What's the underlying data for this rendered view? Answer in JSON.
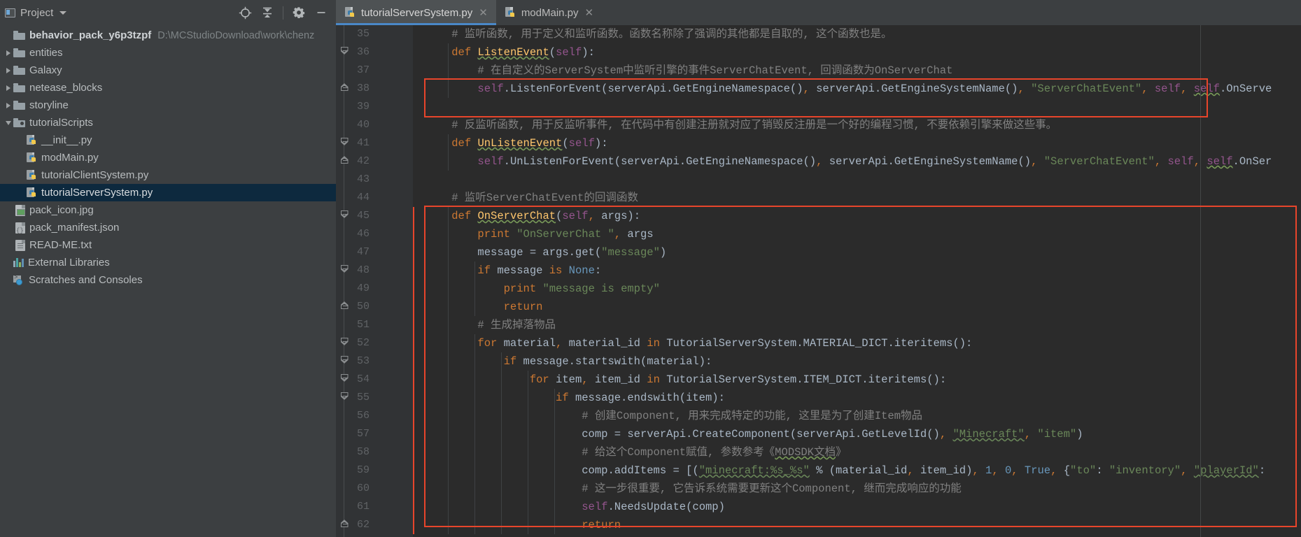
{
  "window": {
    "app": "PyCharm-like IDE",
    "bg": "#3c3f41",
    "editor_bg": "#2b2b2b"
  },
  "project_panel": {
    "title": "Project",
    "title_icon": "project-icon",
    "caret_icon": "chevron-down-icon",
    "toolbar_icons": [
      {
        "name": "locate-target-icon",
        "glyph": "target"
      },
      {
        "name": "collapse-all-icon",
        "glyph": "collapse"
      },
      {
        "name": "settings-gear-icon",
        "glyph": "gear"
      },
      {
        "name": "hide-panel-icon",
        "glyph": "minus"
      }
    ],
    "tree": [
      {
        "label": "behavior_pack_y6p3tzpf",
        "path": "D:\\MCStudioDownload\\work\\chenz",
        "icon": "folder-icon",
        "indent": 0,
        "arrow": "none",
        "bold": true,
        "selected": false
      },
      {
        "label": "entities",
        "path": "",
        "icon": "folder-icon",
        "indent": 1,
        "arrow": "right",
        "bold": false,
        "selected": false
      },
      {
        "label": "Galaxy",
        "path": "",
        "icon": "folder-icon",
        "indent": 1,
        "arrow": "right",
        "bold": false,
        "selected": false
      },
      {
        "label": "netease_blocks",
        "path": "",
        "icon": "folder-icon",
        "indent": 1,
        "arrow": "right",
        "bold": false,
        "selected": false
      },
      {
        "label": "storyline",
        "path": "",
        "icon": "folder-icon",
        "indent": 1,
        "arrow": "right",
        "bold": false,
        "selected": false
      },
      {
        "label": "tutorialScripts",
        "path": "",
        "icon": "source-folder-icon",
        "indent": 1,
        "arrow": "down",
        "bold": false,
        "selected": false
      },
      {
        "label": "__init__.py",
        "path": "",
        "icon": "python-file-icon",
        "indent": 2,
        "arrow": "none",
        "bold": false,
        "selected": false
      },
      {
        "label": "modMain.py",
        "path": "",
        "icon": "python-file-icon",
        "indent": 2,
        "arrow": "none",
        "bold": false,
        "selected": false
      },
      {
        "label": "tutorialClientSystem.py",
        "path": "",
        "icon": "python-file-icon",
        "indent": 2,
        "arrow": "none",
        "bold": false,
        "selected": false
      },
      {
        "label": "tutorialServerSystem.py",
        "path": "",
        "icon": "python-file-icon",
        "indent": 2,
        "arrow": "none",
        "bold": false,
        "selected": true
      },
      {
        "label": "pack_icon.jpg",
        "path": "",
        "icon": "image-file-icon",
        "indent": 3,
        "arrow": "none",
        "bold": false,
        "selected": false
      },
      {
        "label": "pack_manifest.json",
        "path": "",
        "icon": "json-file-icon",
        "indent": 3,
        "arrow": "none",
        "bold": false,
        "selected": false
      },
      {
        "label": "READ-ME.txt",
        "path": "",
        "icon": "text-file-icon",
        "indent": 3,
        "arrow": "none",
        "bold": false,
        "selected": false
      },
      {
        "label": "External Libraries",
        "path": "",
        "icon": "libraries-icon",
        "indent": 0,
        "arrow": "none",
        "bold": false,
        "selected": false
      },
      {
        "label": "Scratches and Consoles",
        "path": "",
        "icon": "scratches-icon",
        "indent": 0,
        "arrow": "none",
        "bold": false,
        "selected": false
      }
    ]
  },
  "tabs": [
    {
      "label": "tutorialServerSystem.py",
      "icon": "python-file-icon",
      "close_icon": "close-icon",
      "active": true
    },
    {
      "label": "modMain.py",
      "icon": "python-file-icon",
      "close_icon": "close-icon",
      "active": false
    }
  ],
  "editor": {
    "first_line_number": 35,
    "last_line_number": 62,
    "line_numbers": [
      35,
      36,
      37,
      38,
      39,
      40,
      41,
      42,
      43,
      44,
      45,
      46,
      47,
      48,
      49,
      50,
      51,
      52,
      53,
      54,
      55,
      56,
      57,
      58,
      59,
      60,
      61,
      62
    ],
    "lines": [
      {
        "n": 35,
        "text": "    # 监听函数, 用于定义和监听函数。函数名称除了强调的其他都是自取的, 这个函数也是。"
      },
      {
        "n": 36,
        "text": "    def ListenEvent(self):"
      },
      {
        "n": 37,
        "text": "        # 在自定义的ServerSystem中监听引擎的事件ServerChatEvent, 回调函数为OnServerChat"
      },
      {
        "n": 38,
        "text": "        self.ListenForEvent(serverApi.GetEngineNamespace(), serverApi.GetEngineSystemName(), \"ServerChatEvent\", self, self.OnServe"
      },
      {
        "n": 39,
        "text": ""
      },
      {
        "n": 40,
        "text": "    # 反监听函数, 用于反监听事件, 在代码中有创建注册就对应了销毁反注册是一个好的编程习惯, 不要依赖引擎来做这些事。"
      },
      {
        "n": 41,
        "text": "    def UnListenEvent(self):"
      },
      {
        "n": 42,
        "text": "        self.UnListenForEvent(serverApi.GetEngineNamespace(), serverApi.GetEngineSystemName(), \"ServerChatEvent\", self, self.OnSer"
      },
      {
        "n": 43,
        "text": ""
      },
      {
        "n": 44,
        "text": "    # 监听ServerChatEvent的回调函数"
      },
      {
        "n": 45,
        "text": "    def OnServerChat(self, args):"
      },
      {
        "n": 46,
        "text": "        print \"OnServerChat \", args"
      },
      {
        "n": 47,
        "text": "        message = args.get(\"message\")"
      },
      {
        "n": 48,
        "text": "        if message is None:"
      },
      {
        "n": 49,
        "text": "            print \"message is empty\""
      },
      {
        "n": 50,
        "text": "            return"
      },
      {
        "n": 51,
        "text": "        # 生成掉落物品"
      },
      {
        "n": 52,
        "text": "        for material, material_id in TutorialServerSystem.MATERIAL_DICT.iteritems():"
      },
      {
        "n": 53,
        "text": "            if message.startswith(material):"
      },
      {
        "n": 54,
        "text": "                for item, item_id in TutorialServerSystem.ITEM_DICT.iteritems():"
      },
      {
        "n": 55,
        "text": "                    if message.endswith(item):"
      },
      {
        "n": 56,
        "text": "                        # 创建Component, 用来完成特定的功能, 这里是为了创建Item物品"
      },
      {
        "n": 57,
        "text": "                        comp = serverApi.CreateComponent(serverApi.GetLevelId(), \"Minecraft\", \"item\")"
      },
      {
        "n": 58,
        "text": "                        # 给这个Component赋值, 参数参考《MODSDK文档》"
      },
      {
        "n": 59,
        "text": "                        comp.addItems = [(\"minecraft:%s_%s\" % (material_id, item_id), 1, 0, True, {\"to\": \"inventory\", \"playerId\":"
      },
      {
        "n": 60,
        "text": "                        # 这一步很重要, 它告诉系统需要更新这个Component, 继而完成响应的功能"
      },
      {
        "n": 61,
        "text": "                        self.NeedsUpdate(comp)"
      },
      {
        "n": 62,
        "text": "                        return"
      }
    ],
    "fold_markers": [
      {
        "line": 36,
        "type": "open"
      },
      {
        "line": 38,
        "type": "close"
      },
      {
        "line": 41,
        "type": "open"
      },
      {
        "line": 42,
        "type": "close"
      },
      {
        "line": 45,
        "type": "open"
      },
      {
        "line": 48,
        "type": "open"
      },
      {
        "line": 50,
        "type": "close"
      },
      {
        "line": 52,
        "type": "open"
      },
      {
        "line": 53,
        "type": "open"
      },
      {
        "line": 54,
        "type": "open"
      },
      {
        "line": 55,
        "type": "open"
      },
      {
        "line": 62,
        "type": "close"
      }
    ],
    "annotations": {
      "highlight_color": "#e8452b",
      "boxes": [
        {
          "name": "listen-for-event-highlight",
          "lines": "37-38"
        },
        {
          "name": "on-server-chat-highlight",
          "lines": "44-62"
        }
      ]
    },
    "colors": {
      "comment": "#808080",
      "keyword": "#cc7832",
      "function": "#ffc66d",
      "self": "#94558d",
      "string": "#6a8759",
      "number": "#6897bb",
      "plain": "#a9b7c6",
      "gutter_text": "#606366",
      "gutter_bg": "#313335"
    }
  }
}
